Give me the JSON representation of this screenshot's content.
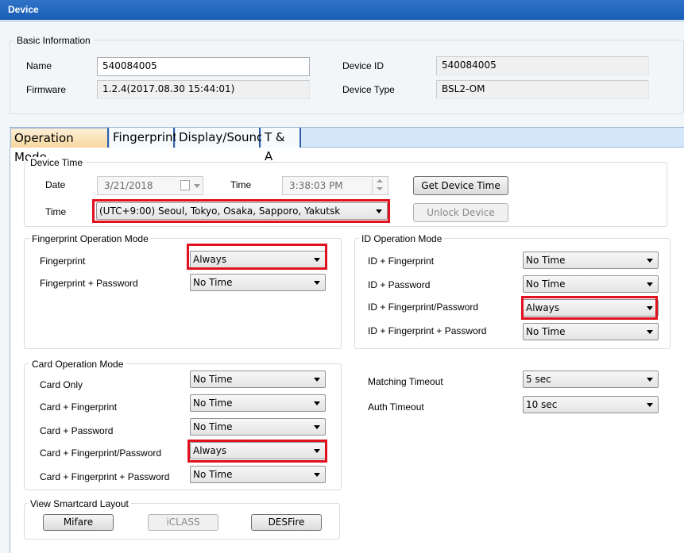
{
  "window": {
    "title": "Device"
  },
  "basic": {
    "legend": "Basic Information",
    "name_label": "Name",
    "name_value": "540084005",
    "firmware_label": "Firmware",
    "firmware_value": "1.2.4(2017.08.30 15:44:01)",
    "device_id_label": "Device ID",
    "device_id_value": "540084005",
    "device_type_label": "Device Type",
    "device_type_value": "BSL2-OM"
  },
  "tabs": [
    {
      "label": "Operation Mode",
      "active": true
    },
    {
      "label": "Fingerprint",
      "active": false
    },
    {
      "label": "Display/Sound",
      "active": false
    },
    {
      "label": "T & A",
      "active": false
    }
  ],
  "device_time": {
    "legend": "Device Time",
    "date_label": "Date",
    "date_value": "3/21/2018",
    "time_label": "Time",
    "time_value": "3:38:03 PM",
    "tz_label": "Time",
    "tz_value": "(UTC+9:00) Seoul, Tokyo, Osaka, Sapporo, Yakutsk",
    "get_time_button": "Get Device Time",
    "unlock_button": "Unlock Device"
  },
  "fp_mode": {
    "legend": "Fingerprint Operation Mode",
    "rows": [
      {
        "label": "Fingerprint",
        "value": "Always"
      },
      {
        "label": "Fingerprint + Password",
        "value": "No Time"
      }
    ]
  },
  "id_mode": {
    "legend": "ID Operation Mode",
    "rows": [
      {
        "label": "ID + Fingerprint",
        "value": "No Time"
      },
      {
        "label": "ID + Password",
        "value": "No Time"
      },
      {
        "label": "ID + Fingerprint/Password",
        "value": "Always"
      },
      {
        "label": "ID + Fingerprint + Password",
        "value": "No Time"
      }
    ]
  },
  "card_mode": {
    "legend": "Card Operation Mode",
    "rows": [
      {
        "label": "Card Only",
        "value": "No Time"
      },
      {
        "label": "Card + Fingerprint",
        "value": "No Time"
      },
      {
        "label": "Card + Password",
        "value": "No Time"
      },
      {
        "label": "Card + Fingerprint/Password",
        "value": "Always"
      },
      {
        "label": "Card + Fingerprint + Password",
        "value": "No Time"
      }
    ]
  },
  "timeouts": {
    "matching_label": "Matching Timeout",
    "matching_value": "5 sec",
    "auth_label": "Auth Timeout",
    "auth_value": "10 sec"
  },
  "smartcard": {
    "legend": "View Smartcard Layout",
    "mifare": "Mifare",
    "iclass": "iCLASS",
    "desfire": "DESFire"
  },
  "colors": {
    "highlight": "#e0101e",
    "titlebar": "#1a5fb6",
    "active_tab": "#f7d79e"
  }
}
